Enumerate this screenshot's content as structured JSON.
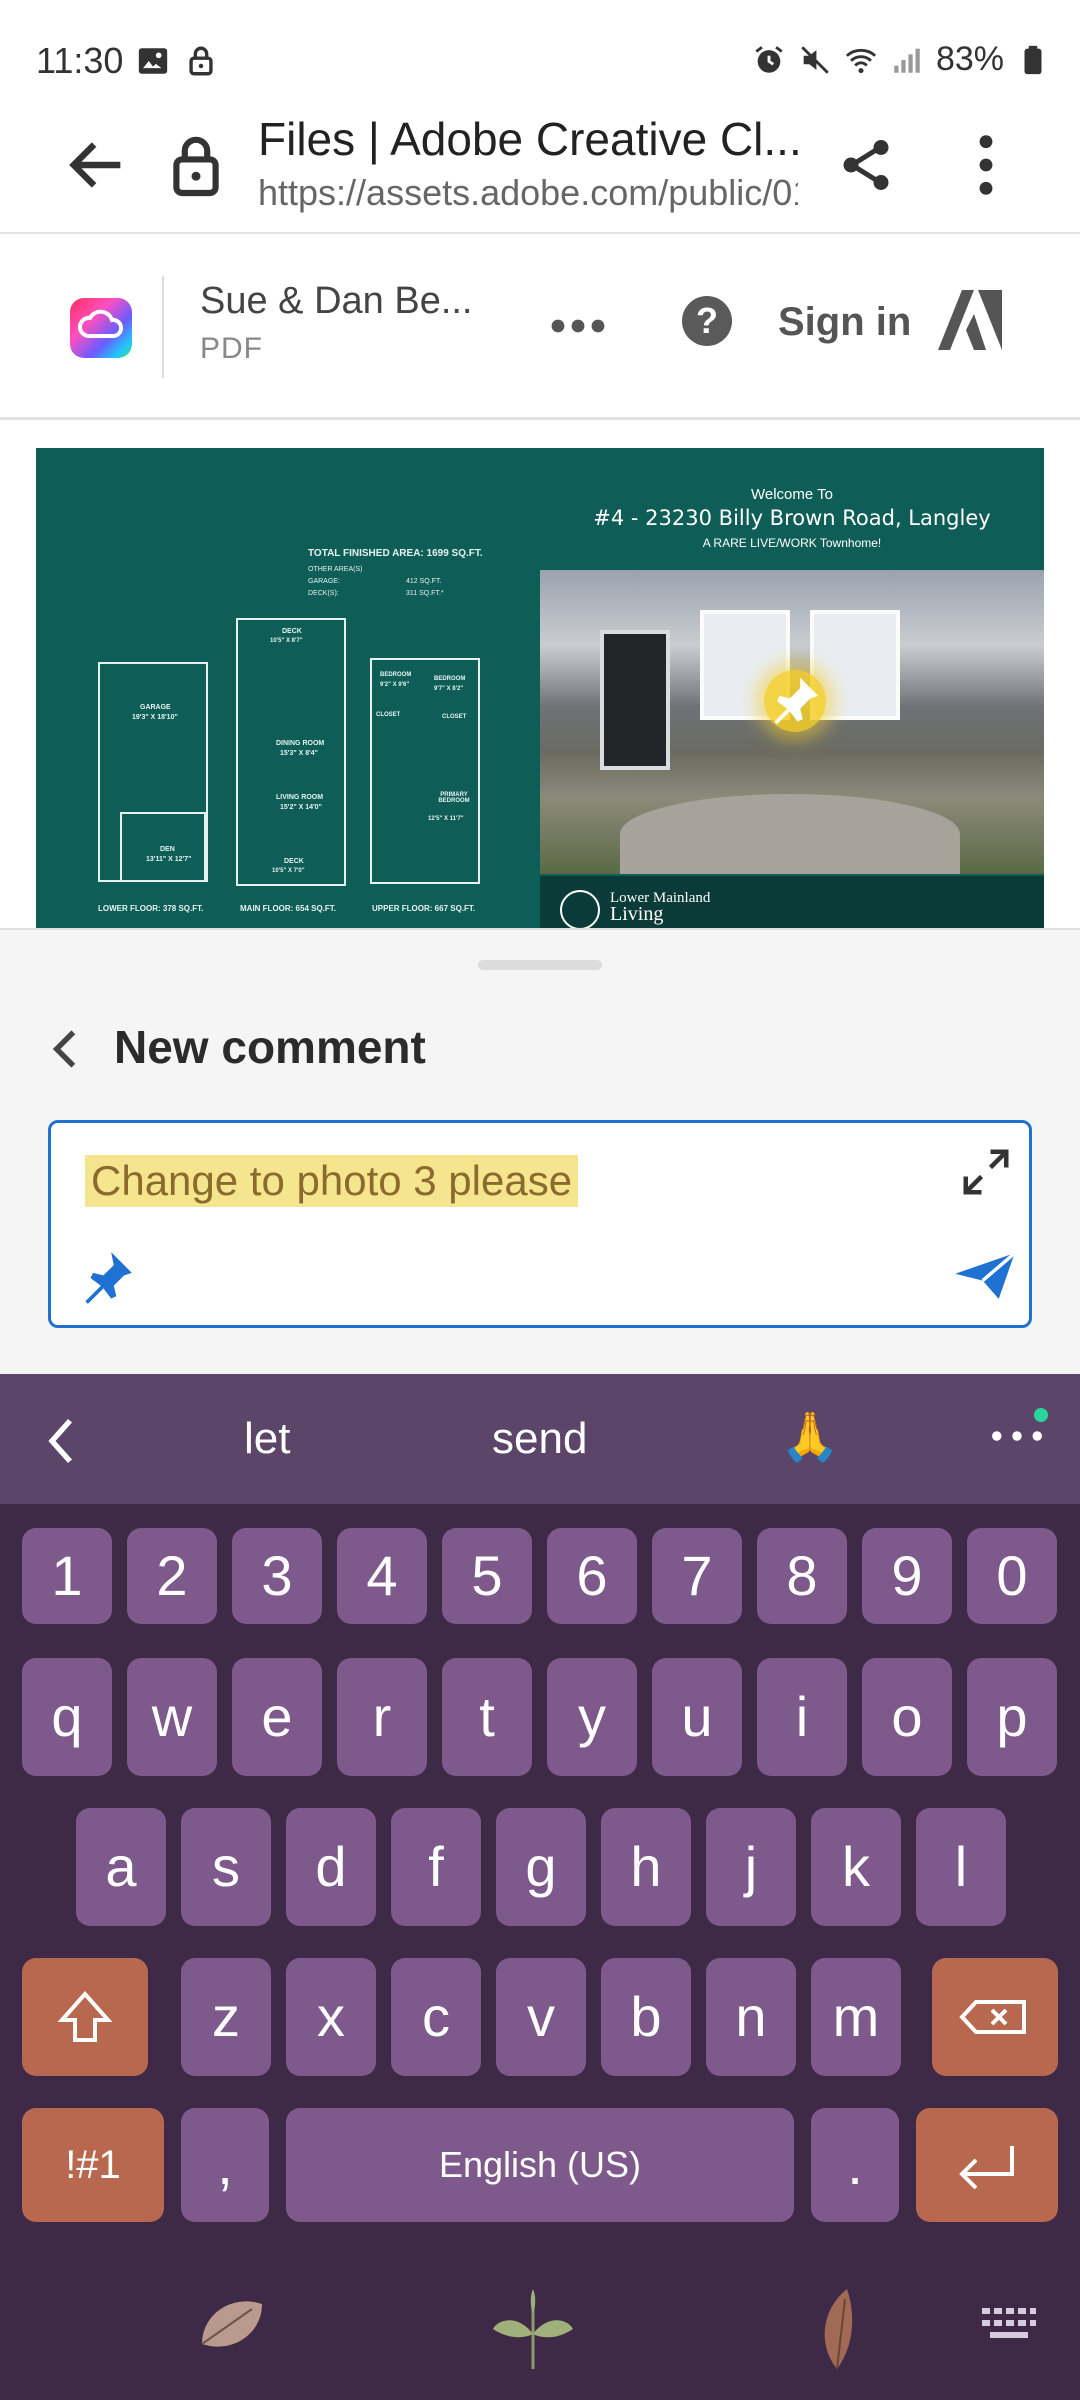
{
  "status_bar": {
    "time": "11:30",
    "battery": "83%"
  },
  "browser": {
    "title": "Files | Adobe Creative Cl...",
    "url": "https://assets.adobe.com/public/01("
  },
  "app_bar": {
    "document_name": "Sue & Dan Be...",
    "document_type": "PDF",
    "sign_in": "Sign in"
  },
  "preview": {
    "floorplan": {
      "total_area": "TOTAL FINISHED AREA: 1699 SQ.FT.",
      "other_areas": "OTHER AREA(S)",
      "garage_label": "GARAGE:",
      "garage_value": "412 SQ.FT.",
      "decks_label": "DECK(S):",
      "decks_value": "311 SQ.FT.*",
      "rooms": {
        "garage": "GARAGE",
        "garage_size": "19'3\" X 18'10\"",
        "den": "DEN",
        "den_size": "13'11\" X 12'7\"",
        "deck_top": "DECK",
        "deck_top_size": "10'5\" X 8'7\"",
        "dining": "DINING ROOM",
        "dining_size": "15'3\" X 8'4\"",
        "living": "LIVING ROOM",
        "living_size": "15'2\" X 14'0\"",
        "deck_bottom": "DECK",
        "deck_bottom_size": "10'5\" X 7'0\"",
        "bedroom1": "BEDROOM",
        "bedroom1_size": "9'2\" X 9'6\"",
        "bedroom2": "BEDROOM",
        "bedroom2_size": "9'7\" X 8'2\"",
        "closet1": "CLOSET",
        "closet2": "CLOSET",
        "primary": "PRIMARY BEDROOM",
        "primary_size": "12'5\" X 11'7\""
      },
      "lower_floor": "LOWER FLOOR: 378 SQ.FT.",
      "main_floor": "MAIN FLOOR: 654 SQ.FT.",
      "upper_floor": "UPPER FLOOR: 667 SQ.FT."
    },
    "welcome": "Welcome To",
    "address": "#4 - 23230 Billy Brown Road, Langley",
    "tagline": "A RARE LIVE/WORK Townhome!",
    "brand_line1": "Lower Mainland",
    "brand_line2": "Living"
  },
  "comment_sheet": {
    "title": "New comment",
    "comment_text": "Change to photo 3 please"
  },
  "keyboard": {
    "suggestions": [
      "let",
      "send",
      "🙏"
    ],
    "number_row": [
      "1",
      "2",
      "3",
      "4",
      "5",
      "6",
      "7",
      "8",
      "9",
      "0"
    ],
    "row1": [
      "q",
      "w",
      "e",
      "r",
      "t",
      "y",
      "u",
      "i",
      "o",
      "p"
    ],
    "row2": [
      "a",
      "s",
      "d",
      "f",
      "g",
      "h",
      "j",
      "k",
      "l"
    ],
    "row3": [
      "z",
      "x",
      "c",
      "v",
      "b",
      "n",
      "m"
    ],
    "symbols_key": "!#1",
    "comma_key": ",",
    "space_key": "English (US)",
    "period_key": "."
  },
  "colors": {
    "accent_blue": "#1f72d1",
    "keyboard_bg": "#3e2a47",
    "key_bg": "#7e5a8c",
    "func_key_bg": "#b8684e",
    "preview_bg": "#0e5e57",
    "highlight": "#f6e58f"
  }
}
